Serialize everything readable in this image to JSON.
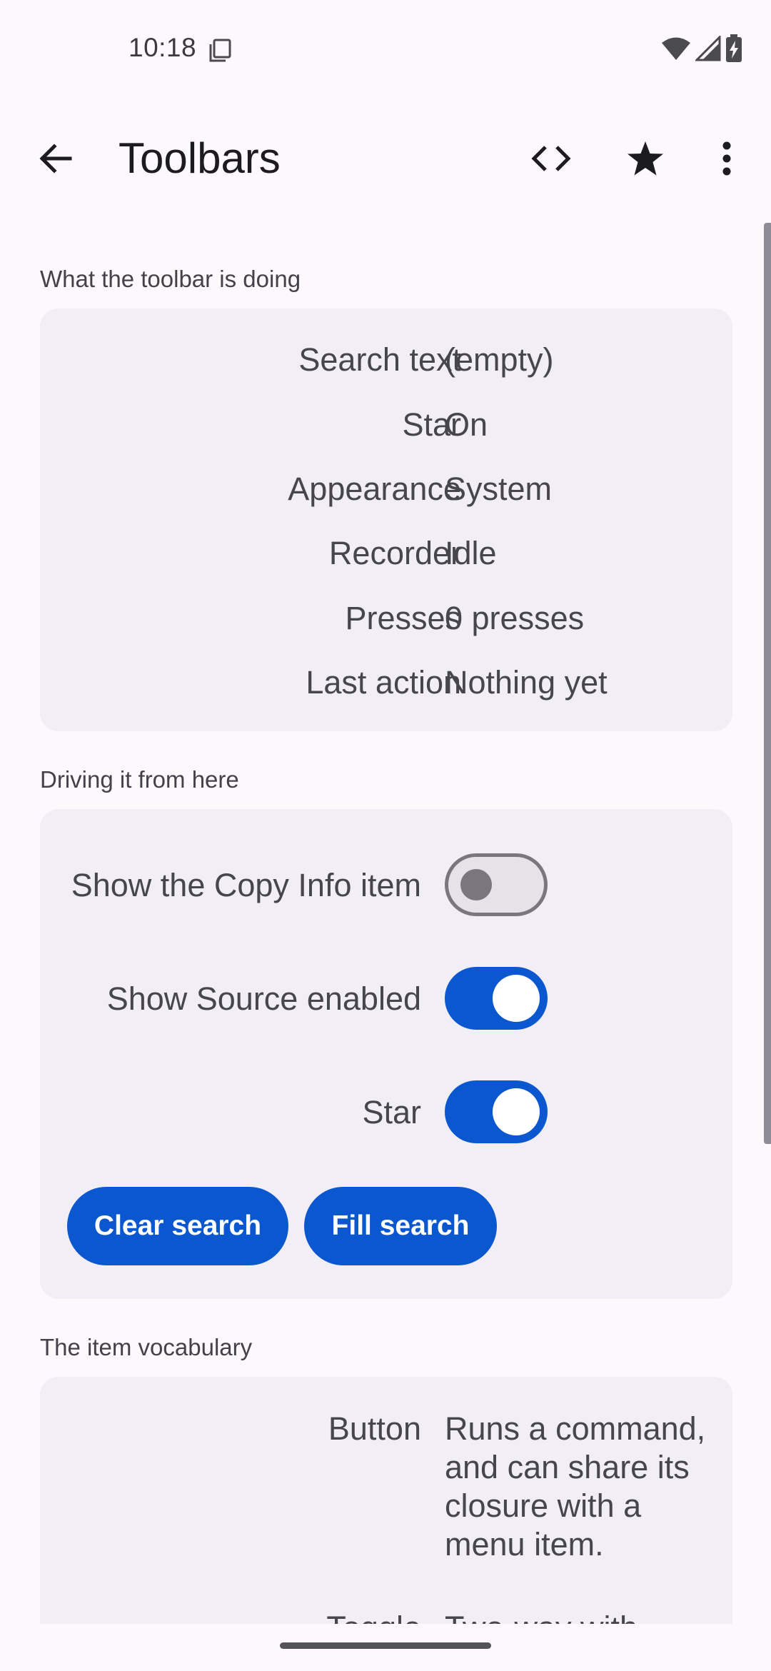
{
  "status_bar": {
    "time": "10:18"
  },
  "app_bar": {
    "title": "Toolbars",
    "icons": [
      "arrow-back-icon",
      "code-icon",
      "star-icon",
      "more-vert-icon"
    ]
  },
  "status_section": {
    "label": "What the toolbar is doing",
    "rows": [
      {
        "key": "Search text",
        "value": "(empty)"
      },
      {
        "key": "Star",
        "value": "On"
      },
      {
        "key": "Appearance",
        "value": "System"
      },
      {
        "key": "Recorder",
        "value": "Idle"
      },
      {
        "key": "Presses",
        "value": "0 presses"
      },
      {
        "key": "Last action",
        "value": "Nothing yet"
      }
    ]
  },
  "controls_section": {
    "label": "Driving it from here",
    "switches": [
      {
        "label": "Show the Copy Info item",
        "on": false
      },
      {
        "label": "Show Source enabled",
        "on": true
      },
      {
        "label": "Star",
        "on": true
      }
    ],
    "buttons": {
      "clear_search": "Clear search",
      "fill_search": "Fill search"
    }
  },
  "vocab_section": {
    "label": "The item vocabulary",
    "items": [
      {
        "key": "Button",
        "description": "Runs a command, and can share its closure with a menu item."
      },
      {
        "key": "Toggle",
        "description": "Two-way with"
      }
    ]
  },
  "colors": {
    "background": "#FCF8FC",
    "card": "#F2EEF5",
    "accent": "#0B57D0"
  }
}
